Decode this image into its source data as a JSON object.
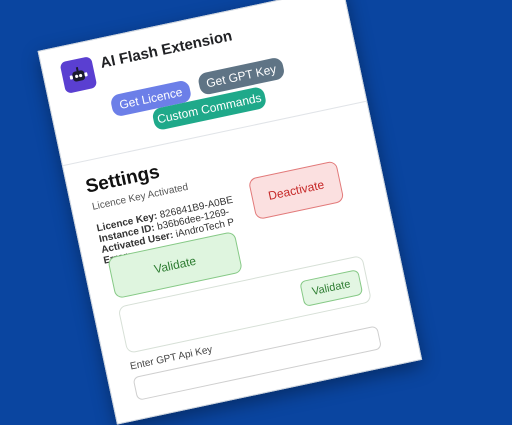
{
  "app": {
    "title": "AI Flash Extension"
  },
  "header": {
    "buttons": {
      "get_licence": "Get Licence",
      "get_gpt_key": "Get GPT Key",
      "custom_commands": "Custom Commands"
    }
  },
  "settings": {
    "title": "Settings",
    "status": "Licence Key Activated",
    "licence_key_label": "Licence Key:",
    "licence_key_value": "826841B9-A0BE",
    "instance_id_label": "Instance ID:",
    "instance_id_value": "b36b6dee-1269-",
    "activated_user_label": "Activated User:",
    "activated_user_value": "iAndroTech P",
    "error_label": "Error:",
    "error_value": "",
    "deactivate_label": "Deactivate",
    "validate_label": "Validate"
  },
  "gpt": {
    "validate_label": "Validate",
    "api_key_label": "Enter GPT Api Key",
    "api_key_value": ""
  },
  "colors": {
    "background": "#0a45a0",
    "logo": "#5a3fd1",
    "get_licence": "#6c7fe8",
    "get_gpt_key": "#5f7485",
    "custom_commands": "#1fa98a",
    "validate": "#dff5df",
    "deactivate": "#fbe0e0"
  }
}
